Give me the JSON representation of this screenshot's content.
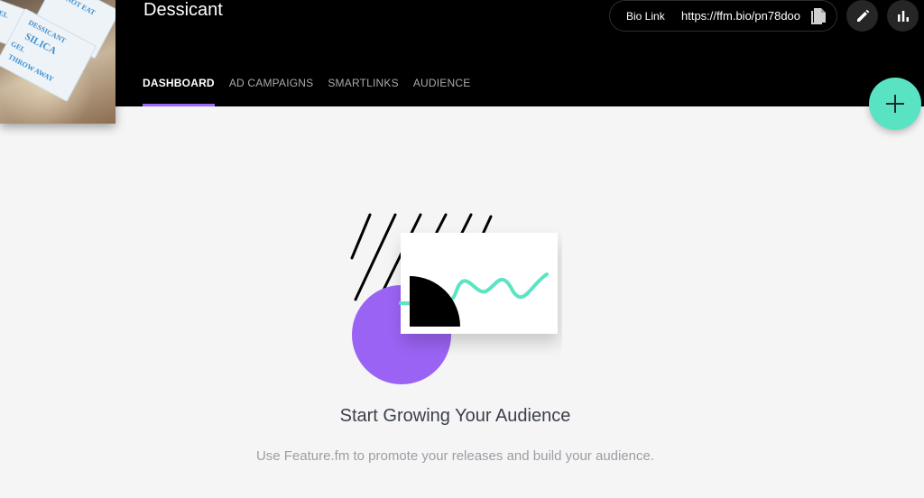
{
  "artist": {
    "name": "Dessicant"
  },
  "artwork": {
    "packet_texts": [
      "DESSICANT",
      "SILICA",
      "GEL",
      "THROW AWAY",
      "DO NOT EAT"
    ]
  },
  "bio_link": {
    "label": "Bio Link",
    "url": "https://ffm.bio/pn78doo"
  },
  "icons": {
    "copy": "copy-icon",
    "edit": "pencil-icon",
    "stats": "bar-chart-icon",
    "add": "plus-icon"
  },
  "tabs": [
    {
      "label": "DASHBOARD",
      "active": true
    },
    {
      "label": "AD CAMPAIGNS",
      "active": false
    },
    {
      "label": "SMARTLINKS",
      "active": false
    },
    {
      "label": "AUDIENCE",
      "active": false
    }
  ],
  "empty_state": {
    "title": "Start Growing Your Audience",
    "subtitle": "Use Feature.fm to promote your releases and build your audience."
  },
  "colors": {
    "accent_purple": "#9b6bf3",
    "fab_teal": "#59e3c3",
    "header_bg": "#000000",
    "page_bg": "#f5f5f5"
  }
}
